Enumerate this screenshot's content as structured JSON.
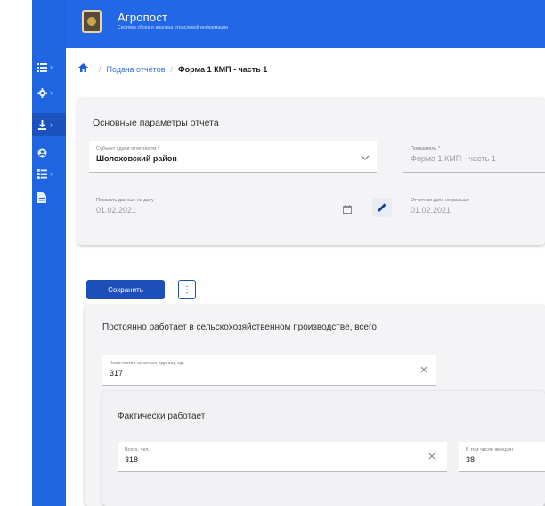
{
  "header": {
    "title": "Агропост",
    "subtitle": "Система сбора и анализа отраслевой информации"
  },
  "sidebar": {
    "items": [
      {
        "icon": "list-icon"
      },
      {
        "icon": "gear-icon"
      },
      {
        "icon": "download-icon"
      },
      {
        "icon": "user-icon"
      },
      {
        "icon": "tasks-icon"
      },
      {
        "icon": "document-icon"
      }
    ]
  },
  "breadcrumb": {
    "home_icon": "home-icon",
    "link": "Подача отчётов",
    "current": "Форма 1 КМП - часть 1"
  },
  "params": {
    "title": "Основные параметры отчета",
    "subject": {
      "label": "Субъект сдачи отчетности *",
      "value": "Шолоховский район"
    },
    "indicator": {
      "label": "Показатель *",
      "value": "Форма 1 КМП - часть 1"
    },
    "date_on": {
      "label": "Показать данные на дату",
      "value": "01.02.2021"
    },
    "report_date": {
      "label": "Отчетная дата не раньше",
      "value": "01.02.2021"
    }
  },
  "toolbar": {
    "save_label": "Сохранить",
    "more_label": "⋮"
  },
  "section1": {
    "title": "Постоянно работает в сельскохозяйственном производстве, всего",
    "staff": {
      "label": "Количество штатных единиц, ед.",
      "value": "317"
    }
  },
  "section2": {
    "title": "Фактически работает",
    "total": {
      "label": "Всего, чел.",
      "value": "318"
    },
    "women": {
      "label": "В том числе женщин",
      "value": "38"
    }
  }
}
